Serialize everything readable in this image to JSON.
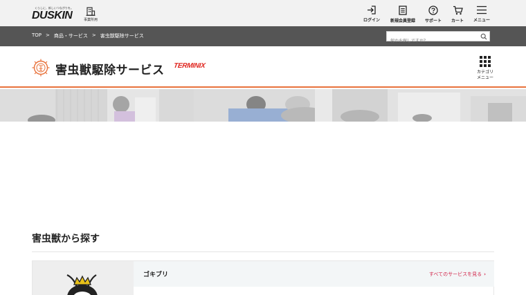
{
  "header": {
    "logo_tagline": "くらしに、新しいつながりを。",
    "logo_text": "DUSKIN",
    "office_label": "事業所用",
    "nav": [
      {
        "label": "ログイン",
        "icon": "login-icon"
      },
      {
        "label": "新規会員登録",
        "icon": "register-form-icon"
      },
      {
        "label": "サポート",
        "icon": "help-circle-icon"
      },
      {
        "label": "カート",
        "icon": "cart-icon"
      },
      {
        "label": "メニュー",
        "icon": "hamburger-menu-icon"
      }
    ]
  },
  "breadcrumb": {
    "items": [
      "TOP",
      "商品・サービス",
      "害虫獣駆除サービス"
    ],
    "separator": ">"
  },
  "search": {
    "placeholder": "何かお探しですか？"
  },
  "service": {
    "title": "害虫獣駆除サービス",
    "brand": "TERMINIX",
    "category_menu_label": "カテゴリ\nメニュー",
    "accent_color": "#e8713a"
  },
  "section": {
    "title": "害虫獣から探す"
  },
  "card": {
    "name": "ゴキブリ",
    "link_label": "すべてのサービスを見る",
    "link_chevron": "›",
    "link_color": "#d2254a"
  }
}
